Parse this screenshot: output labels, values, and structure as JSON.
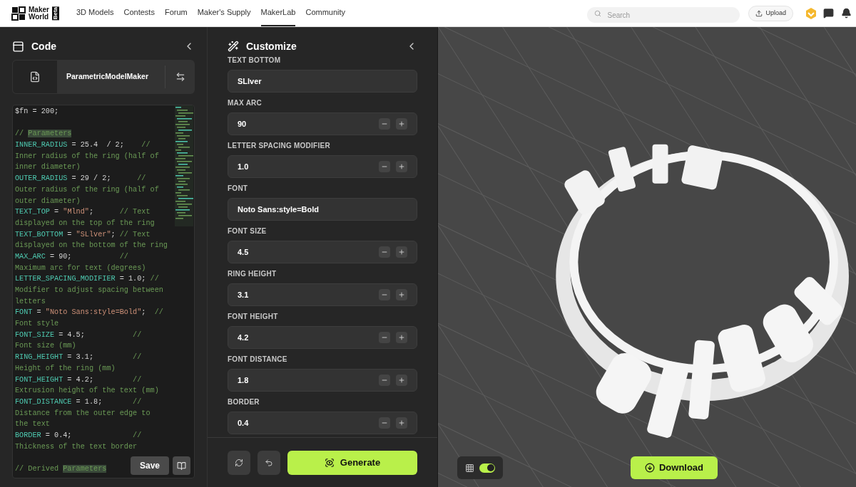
{
  "nav": {
    "logo_top": "Maker",
    "logo_bottom": "World",
    "logo_badge": "Beta",
    "links": [
      {
        "label": "3D Models",
        "selected": false
      },
      {
        "label": "Contests",
        "selected": false
      },
      {
        "label": "Forum",
        "selected": false
      },
      {
        "label": "Maker's Supply",
        "selected": false
      },
      {
        "label": "MakerLab",
        "selected": true
      },
      {
        "label": "Community",
        "selected": false
      }
    ],
    "search": {
      "placeholder": "Search"
    },
    "upload": "Upload"
  },
  "code_panel": {
    "title": "Code",
    "file": "ParametricModelMaker",
    "save": "Save",
    "blocks": [
      [
        [
          {
            "kind": "plain",
            "text": "$fn = 200;"
          }
        ]
      ],
      [
        [
          {
            "kind": "comment",
            "text": "// "
          },
          {
            "kind": "highlight",
            "text": "Parameters"
          }
        ],
        [
          {
            "kind": "ident",
            "text": "INNER_RADIUS"
          },
          {
            "kind": "plain",
            "text": " = 25.4  / 2;    "
          },
          {
            "kind": "comment",
            "text": "//"
          }
        ],
        [
          {
            "kind": "comment",
            "text": "Inner radius of the ring (half of"
          }
        ],
        [
          {
            "kind": "comment",
            "text": "inner diameter)"
          }
        ],
        [
          {
            "kind": "ident",
            "text": "OUTER_RADIUS"
          },
          {
            "kind": "plain",
            "text": " = 29 / 2;      "
          },
          {
            "kind": "comment",
            "text": "//"
          }
        ],
        [
          {
            "kind": "comment",
            "text": "Outer radius of the ring (half of"
          }
        ],
        [
          {
            "kind": "comment",
            "text": "outer diameter)"
          }
        ],
        [
          {
            "kind": "ident",
            "text": "TEXT_TOP"
          },
          {
            "kind": "plain",
            "text": " = "
          },
          {
            "kind": "string",
            "text": "\"Mlnd\""
          },
          {
            "kind": "plain",
            "text": ";      "
          },
          {
            "kind": "comment",
            "text": "// Text"
          }
        ],
        [
          {
            "kind": "comment",
            "text": "displayed on the top of the ring"
          }
        ],
        [
          {
            "kind": "ident",
            "text": "TEXT_BOTTOM"
          },
          {
            "kind": "plain",
            "text": " = "
          },
          {
            "kind": "string",
            "text": "\"SLlver\""
          },
          {
            "kind": "plain",
            "text": "; "
          },
          {
            "kind": "comment",
            "text": "// Text"
          }
        ],
        [
          {
            "kind": "comment",
            "text": "displayed on the bottom of the ring"
          }
        ],
        [
          {
            "kind": "ident",
            "text": "MAX_ARC"
          },
          {
            "kind": "plain",
            "text": " = 90;           "
          },
          {
            "kind": "comment",
            "text": "//"
          }
        ],
        [
          {
            "kind": "comment",
            "text": "Maximum arc for text (degrees)"
          }
        ],
        [
          {
            "kind": "ident",
            "text": "LETTER_SPACING_MODIFIER"
          },
          {
            "kind": "plain",
            "text": " = 1.0; "
          },
          {
            "kind": "comment",
            "text": "//"
          }
        ],
        [
          {
            "kind": "comment",
            "text": "Modifier to adjust spacing between"
          }
        ],
        [
          {
            "kind": "comment",
            "text": "letters"
          }
        ],
        [
          {
            "kind": "ident",
            "text": "FONT"
          },
          {
            "kind": "plain",
            "text": " = "
          },
          {
            "kind": "string",
            "text": "\"Noto Sans:style=Bold\""
          },
          {
            "kind": "plain",
            "text": ";  "
          },
          {
            "kind": "comment",
            "text": "//"
          }
        ],
        [
          {
            "kind": "comment",
            "text": "Font style"
          }
        ],
        [
          {
            "kind": "ident",
            "text": "FONT_SIZE"
          },
          {
            "kind": "plain",
            "text": " = 4.5;           "
          },
          {
            "kind": "comment",
            "text": "//"
          }
        ],
        [
          {
            "kind": "comment",
            "text": "Font size (mm)"
          }
        ],
        [
          {
            "kind": "ident",
            "text": "RING_HEIGHT"
          },
          {
            "kind": "plain",
            "text": " = 3.1;         "
          },
          {
            "kind": "comment",
            "text": "//"
          }
        ],
        [
          {
            "kind": "comment",
            "text": "Height of the ring (mm)"
          }
        ],
        [
          {
            "kind": "ident",
            "text": "FONT_HEIGHT"
          },
          {
            "kind": "plain",
            "text": " = 4.2;         "
          },
          {
            "kind": "comment",
            "text": "//"
          }
        ],
        [
          {
            "kind": "comment",
            "text": "Extrusion height of the text (mm)"
          }
        ],
        [
          {
            "kind": "ident",
            "text": "FONT_DISTANCE"
          },
          {
            "kind": "plain",
            "text": " = 1.8;       "
          },
          {
            "kind": "comment",
            "text": "//"
          }
        ],
        [
          {
            "kind": "comment",
            "text": "Distance from the outer edge to"
          }
        ],
        [
          {
            "kind": "comment",
            "text": "the text"
          }
        ],
        [
          {
            "kind": "ident",
            "text": "BORDER"
          },
          {
            "kind": "plain",
            "text": " = 0.4;              "
          },
          {
            "kind": "comment",
            "text": "//"
          }
        ],
        [
          {
            "kind": "comment",
            "text": "Thickness of the text border"
          }
        ]
      ],
      [
        [
          {
            "kind": "comment",
            "text": "// Derived "
          },
          {
            "kind": "highlight",
            "text": "Parameters"
          }
        ]
      ]
    ]
  },
  "customize_panel": {
    "title": "Customize",
    "generate": "Generate",
    "fields": [
      {
        "kind": "text",
        "label": "TEXT BOTTOM",
        "value": "SLlver"
      },
      {
        "kind": "stepper",
        "label": "MAX ARC",
        "value": "90"
      },
      {
        "kind": "stepper",
        "label": "LETTER SPACING MODIFIER",
        "value": "1.0"
      },
      {
        "kind": "text",
        "label": "FONT",
        "value": "Noto Sans:style=Bold"
      },
      {
        "kind": "stepper",
        "label": "FONT SIZE",
        "value": "4.5"
      },
      {
        "kind": "stepper",
        "label": "RING HEIGHT",
        "value": "3.1"
      },
      {
        "kind": "stepper",
        "label": "FONT HEIGHT",
        "value": "4.2"
      },
      {
        "kind": "stepper",
        "label": "FONT DISTANCE",
        "value": "1.8"
      },
      {
        "kind": "stepper",
        "label": "BORDER",
        "value": "0.4"
      }
    ]
  },
  "viewport": {
    "grid_toggle": {
      "on": true
    },
    "download": "Download"
  }
}
